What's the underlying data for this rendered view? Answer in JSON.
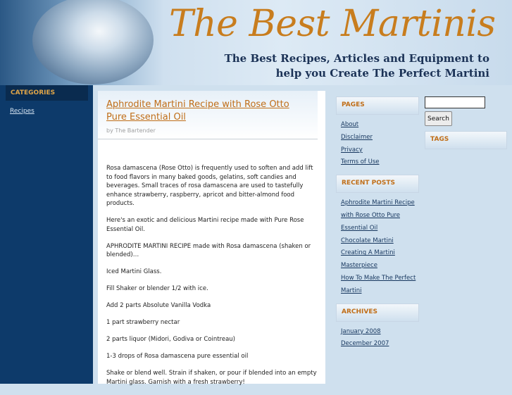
{
  "header": {
    "title": "The Best Martinis",
    "tagline_line1": "The Best Recipes, Articles and Equipment  to",
    "tagline_line2": "help you Create The Perfect Martini"
  },
  "categories": {
    "heading": "CATEGORIES",
    "items": [
      "Recipes"
    ]
  },
  "post": {
    "title": "Aphrodite Martini Recipe with Rose Otto Pure Essential Oil",
    "meta": "by The Bartender",
    "paragraphs": [
      "Rosa damascena (Rose Otto) is frequently used to soften and add lift to food flavors in many baked goods, gelatins, soft candies and beverages. Small traces of rosa damascena are used to tastefully enhance strawberry, raspberry, apricot and bitter-almond food products.",
      "Here's an exotic and delicious Martini recipe made with Pure Rose Essential Oil.",
      "APHRODITE MARTINI RECIPE made with Rosa damascena (shaken or blended)…",
      "Iced Martini Glass.",
      "Fill Shaker or blender 1/2 with ice.",
      "Add 2 parts Absolute Vanilla Vodka",
      "1 part strawberry nectar",
      "2 parts liquor (Midori, Godiva or Cointreau)",
      "1-3 drops of Rosa damascena pure essential oil",
      "Shake or blend well. Strain if shaken, or pour if blended into an empty Martini glass. Garnish with a fresh strawberry!"
    ]
  },
  "pages": {
    "heading": "PAGES",
    "items": [
      "About",
      "Disclaimer",
      "Privacy",
      "Terms of Use"
    ]
  },
  "recent_posts": {
    "heading": "RECENT POSTS",
    "items": [
      "Aphrodite Martini Recipe with Rose Otto Pure Essential Oil",
      "Chocolate Martini",
      "Creating A Martini Masterpiece",
      "How To Make The Perfect Martini"
    ]
  },
  "archives": {
    "heading": "ARCHIVES",
    "items": [
      "January 2008",
      "December 2007"
    ]
  },
  "search": {
    "value": "",
    "button_label": "Search"
  },
  "tags": {
    "heading": "TAGS"
  },
  "colors": {
    "title_orange": "#c87d1e",
    "link_orange": "#c06e18",
    "navy": "#0d3a6a",
    "page_blue": "#cfe0ee"
  }
}
